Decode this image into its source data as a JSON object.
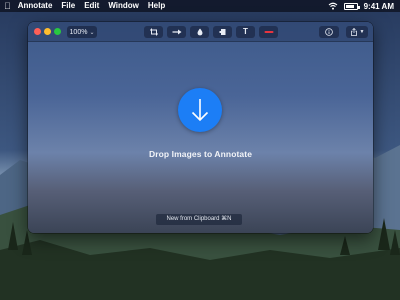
{
  "menubar": {
    "app_name": "Annotate",
    "items": [
      {
        "label": "File"
      },
      {
        "label": "Edit"
      },
      {
        "label": "Window"
      },
      {
        "label": "Help"
      }
    ],
    "time": "9:41 AM"
  },
  "window": {
    "zoom": "100%",
    "tools": [
      {
        "icon": "crop-icon"
      },
      {
        "icon": "arrow-icon"
      },
      {
        "icon": "blur-drop-icon"
      },
      {
        "icon": "highlight-icon"
      },
      {
        "icon": "text-tool-icon",
        "label": "T"
      },
      {
        "icon": "line-color-icon",
        "color": "#e8343f"
      }
    ],
    "drop_title": "Drop Images to Annotate",
    "clipboard_button": "New from Clipboard ⌘N",
    "accent_color": "#1c7ef6"
  }
}
